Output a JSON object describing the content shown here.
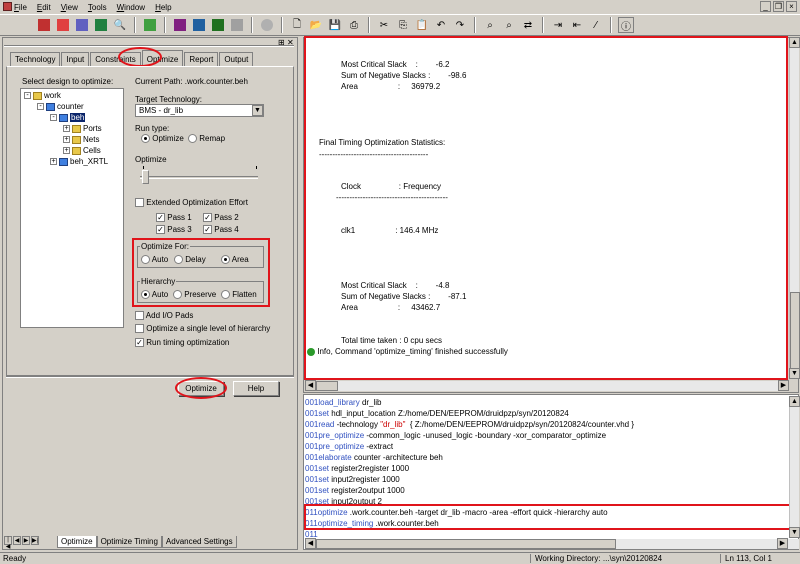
{
  "menu": {
    "items": [
      "File",
      "Edit",
      "View",
      "Tools",
      "Window",
      "Help"
    ]
  },
  "left": {
    "tabs": [
      "Technology",
      "Input",
      "Constraints",
      "Optimize",
      "Report",
      "Output"
    ],
    "select_design_label": "Select design to optimize:",
    "current_path": "Current Path: .work.counter.beh",
    "tree": {
      "work": "work",
      "counter": "counter",
      "beh": "beh",
      "ports": "Ports",
      "nets": "Nets",
      "cells": "Cells",
      "beh_xrtl": "beh_XRTL"
    },
    "target_technology_label": "Target Technology:",
    "target_technology_value": "BMS - dr_lib",
    "run_type_label": "Run type:",
    "run_type": {
      "optimize": "Optimize",
      "remap": "Remap"
    },
    "optimize_label": "Optimize",
    "extended_effort": "Extended Optimization Effort",
    "passes": [
      "Pass 1",
      "Pass 2",
      "Pass 3",
      "Pass 4"
    ],
    "optimize_for_label": "Optimize For:",
    "optimize_for": {
      "auto": "Auto",
      "delay": "Delay",
      "area": "Area"
    },
    "hierarchy_label": "Hierarchy",
    "hierarchy": {
      "auto": "Auto",
      "preserve": "Preserve",
      "flatten": "Flatten"
    },
    "add_io_pads": "Add I/O Pads",
    "single_level": "Optimize a single level of hierarchy",
    "run_timing": "Run timing optimization",
    "optimize_button": "Optimize",
    "help_button": "Help",
    "bottom_tabs": [
      "Optimize",
      "Optimize Timing",
      "Advanced Settings"
    ]
  },
  "console": {
    "lines": [
      "Most Critical Slack    :        -6.2",
      "Sum of Negative Slacks :        -98.6",
      "Area                  :     36979.2",
      "Final Timing Optimization Statistics:",
      "-----------------------------------------",
      "Clock                 : Frequency",
      "------------------------------------------",
      "clk1                  : 146.4 MHz",
      "Most Critical Slack    :        -4.8",
      "Sum of Negative Slacks :        -87.1",
      "Area                  :     43462.7",
      "Total time taken : 0 cpu secs",
      "Info, Command 'optimize_timing' finished successfully"
    ]
  },
  "commands": [
    {
      "num": "001",
      "cmd": "load_library",
      "args": " dr_lib"
    },
    {
      "num": "001",
      "cmd": "set",
      "args": " hdl_input_location Z:/home/DEN/EEPROM/druidpzp/syn/20120824"
    },
    {
      "num": "001",
      "cmd": "read",
      "args": " -technology ",
      "str": "\"dr_lib\"",
      "rest": "  { Z:/home/DEN/EEPROM/druidpzp/syn/20120824/counter.vhd }"
    },
    {
      "num": "001",
      "cmd": "pre_optimize",
      "args": " -common_logic -unused_logic -boundary -xor_comparator_optimize"
    },
    {
      "num": "001",
      "cmd": "pre_optimize",
      "args": " -extract"
    },
    {
      "num": "001",
      "cmd": "elaborate",
      "args": " counter -architecture beh"
    },
    {
      "num": "001",
      "cmd": "set",
      "args": " register2register 1000"
    },
    {
      "num": "001",
      "cmd": "set",
      "args": " input2register 1000"
    },
    {
      "num": "001",
      "cmd": "set",
      "args": " register2output 1000"
    },
    {
      "num": "001",
      "cmd": "set",
      "args": " input2output 2"
    },
    {
      "num": "011",
      "cmd": "optimize",
      "args": " .work.counter.beh -target dr_lib -macro -area -effort quick -hierarchy auto"
    },
    {
      "num": "011",
      "cmd": "optimize_timing",
      "args": " .work.counter.beh"
    },
    {
      "num": "011",
      "cmd": "",
      "args": ""
    }
  ],
  "status": {
    "left": "Ready",
    "working_dir": "Working Directory: ...\\syn\\20120824",
    "position": "Ln 113, Col 1"
  },
  "colors": {
    "highlight": "#e0141b",
    "success": "#2a9a2a",
    "command": "#3050c0"
  }
}
